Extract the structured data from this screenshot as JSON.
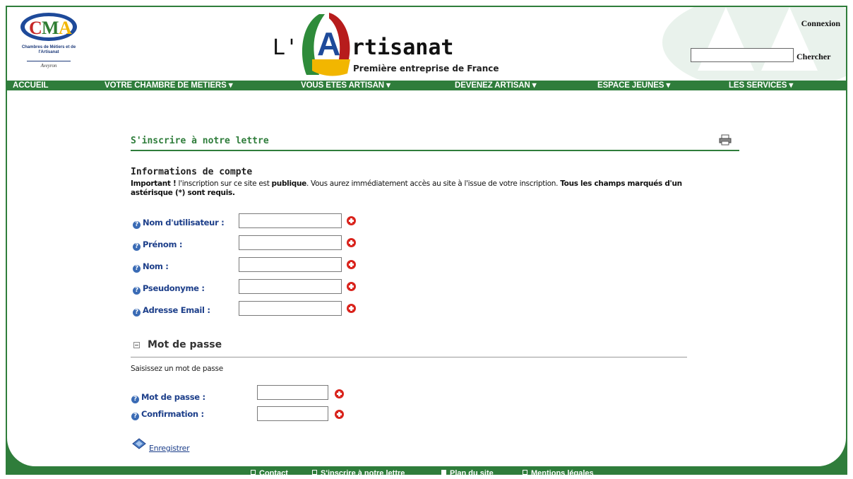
{
  "header": {
    "logo_text": "CMA",
    "logo_caption": "Chambres de Métiers et de l'Artisanat",
    "logo_region": "Aveyron",
    "brand_prefix": "L'",
    "brand_letter": "A",
    "brand_suffix": "rtisanat",
    "brand_tagline": "Première entreprise de France",
    "connexion_link": "Connexion",
    "search_input_value": "",
    "search_button": "Chercher"
  },
  "nav": {
    "items": [
      {
        "label": "ACCUEIL"
      },
      {
        "label": "VOTRE CHAMBRE DE METIERS ▾"
      },
      {
        "label": "VOUS ETES ARTISAN ▾"
      },
      {
        "label": "DEVENEZ ARTISAN ▾"
      },
      {
        "label": "ESPACE JEUNES ▾"
      },
      {
        "label": "LES SERVICES ▾"
      }
    ]
  },
  "page": {
    "title": "S'inscrire à notre lettre",
    "print_icon": "printer-icon"
  },
  "account": {
    "heading": "Informations de compte",
    "intro_important": "Important !",
    "intro_part1": " l'inscription sur ce site est ",
    "intro_publique": "publique",
    "intro_part2": ". Vous aurez immédiatement accès au site à l'issue de votre inscription. ",
    "intro_required": "Tous les champs marqués d'un astérisque (*) sont requis.",
    "fields": [
      {
        "label": "Nom d'utilisateur :",
        "value": ""
      },
      {
        "label": "Prénom :",
        "value": ""
      },
      {
        "label": "Nom :",
        "value": ""
      },
      {
        "label": "Pseudonyme :",
        "value": ""
      },
      {
        "label": "Adresse Email :",
        "value": ""
      }
    ]
  },
  "password": {
    "heading": "Mot de passe",
    "instruction": "Saisissez un mot de passe",
    "fields": [
      {
        "label": "Mot de passe :",
        "value": ""
      },
      {
        "label": "Confirmation :",
        "value": ""
      }
    ]
  },
  "submit": {
    "label": "Enregistrer"
  },
  "footer": {
    "items": [
      {
        "label": "Contact"
      },
      {
        "label": "S'inscrire à notre lettre"
      },
      {
        "label": "Plan du site"
      },
      {
        "label": "Mentions légales"
      }
    ]
  },
  "colors": {
    "brand_green": "#2f7d3b",
    "label_blue": "#1d3f8a",
    "required_red": "#d9231c",
    "title_green": "#2f7d3b"
  }
}
